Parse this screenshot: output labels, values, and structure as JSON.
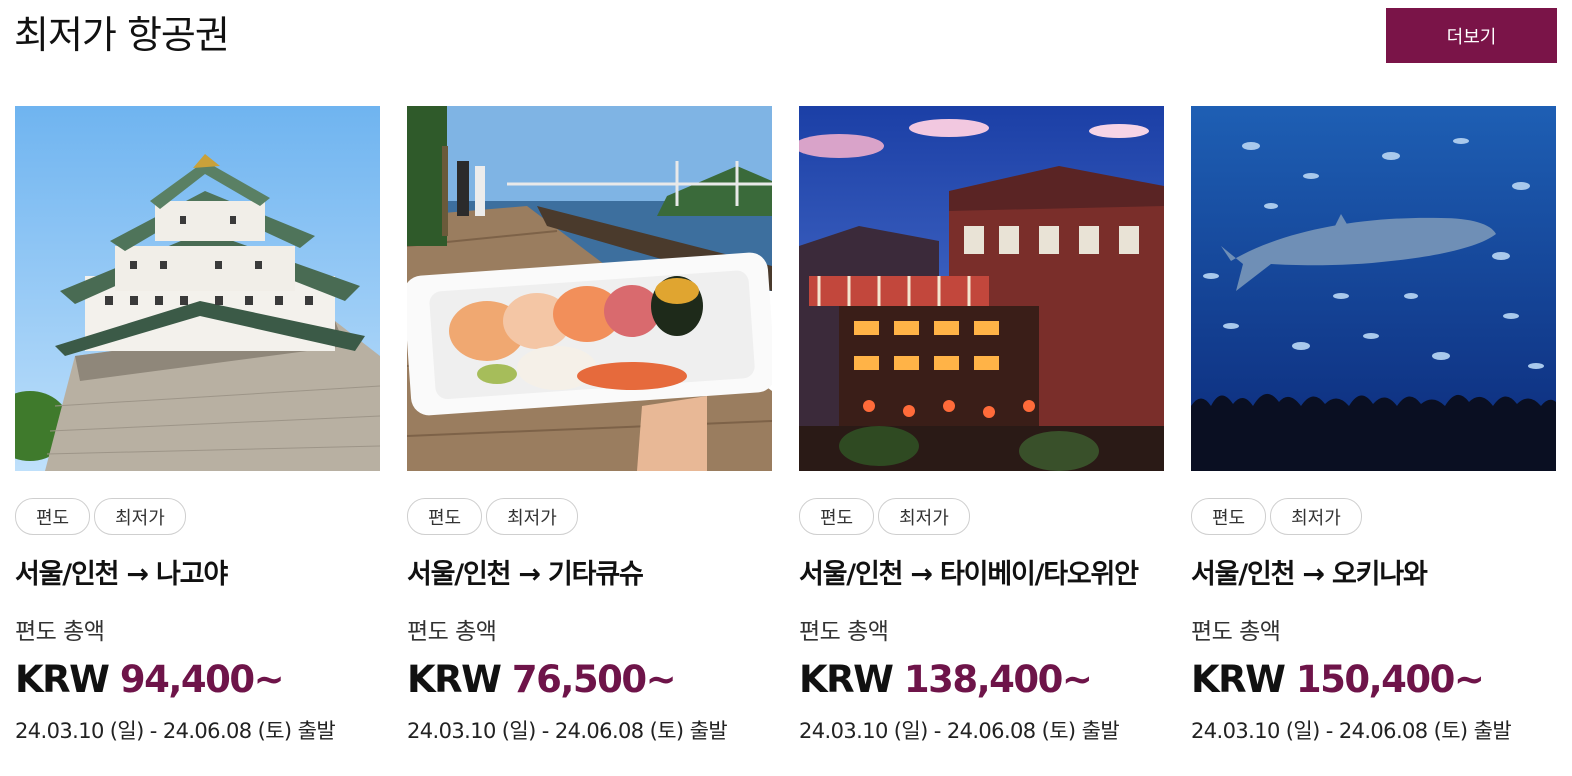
{
  "header": {
    "title": "최저가 항공권",
    "more_label": "더보기"
  },
  "cards": [
    {
      "image": "nagoya-castle-photo",
      "tags": [
        "편도",
        "최저가"
      ],
      "route": "서울/인천 → 나고야",
      "fare_label": "편도 총액",
      "currency": "KRW",
      "amount": "94,400~",
      "dates": "24.03.10 (일) - 24.06.08 (토) 출발"
    },
    {
      "image": "kitakyushu-sushi-photo",
      "tags": [
        "편도",
        "최저가"
      ],
      "route": "서울/인천 → 기타큐슈",
      "fare_label": "편도 총액",
      "currency": "KRW",
      "amount": "76,500~",
      "dates": "24.03.10 (일) - 24.06.08 (토) 출발"
    },
    {
      "image": "taipei-jiufen-photo",
      "tags": [
        "편도",
        "최저가"
      ],
      "route": "서울/인천 → 타이베이/타오위안",
      "fare_label": "편도 총액",
      "currency": "KRW",
      "amount": "138,400~",
      "dates": "24.03.10 (일) - 24.06.08 (토) 출발"
    },
    {
      "image": "okinawa-aquarium-photo",
      "tags": [
        "편도",
        "최저가"
      ],
      "route": "서울/인천 → 오키나와",
      "fare_label": "편도 총액",
      "currency": "KRW",
      "amount": "150,400~",
      "dates": "24.03.10 (일) - 24.06.08 (토) 출발"
    }
  ],
  "colors": {
    "accent": "#7a1448",
    "price": "#6e1449"
  }
}
